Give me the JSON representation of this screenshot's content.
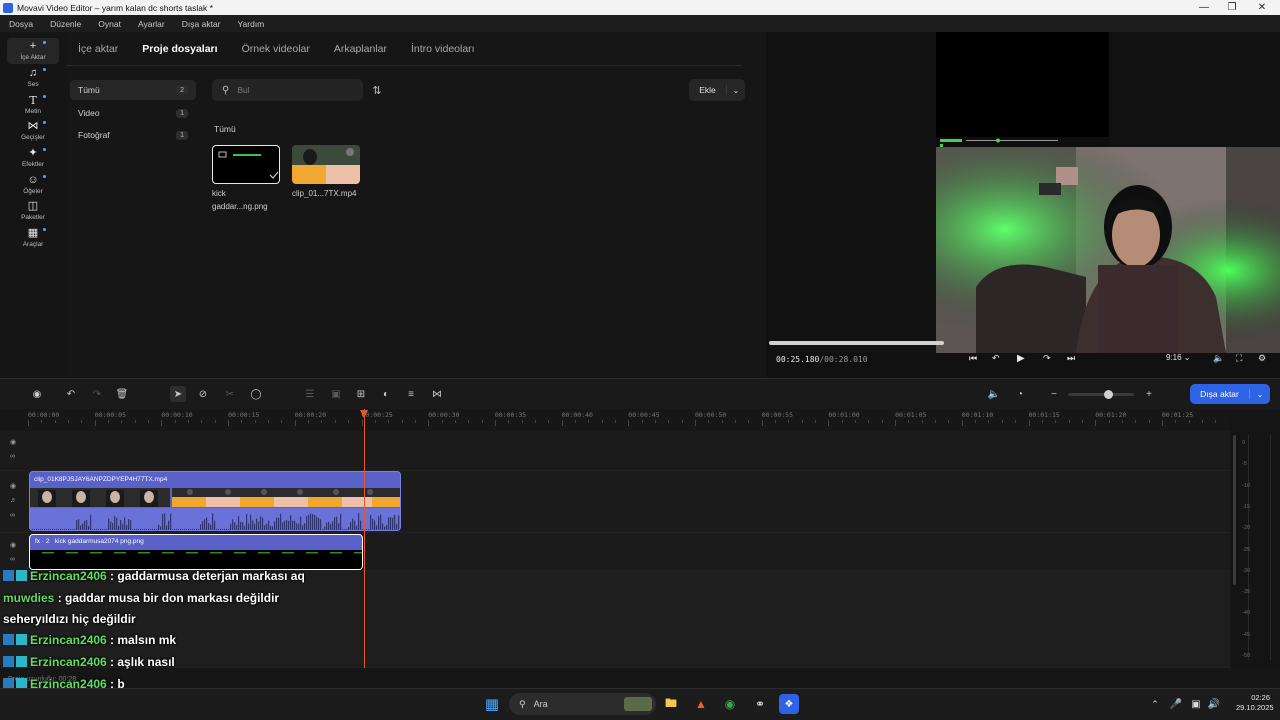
{
  "window": {
    "title": "Movavi Video Editor – yarım kalan dc shorts  taslak *"
  },
  "menu": [
    "Dosya",
    "Düzenle",
    "Oynat",
    "Ayarlar",
    "Dışa aktar",
    "Yardım"
  ],
  "rail": [
    {
      "label": "İçe Aktar",
      "icon": "plus-icon"
    },
    {
      "label": "Ses",
      "icon": "music-icon"
    },
    {
      "label": "Metin",
      "icon": "text-icon"
    },
    {
      "label": "Geçişler",
      "icon": "transitions-icon"
    },
    {
      "label": "Efektler",
      "icon": "effects-icon"
    },
    {
      "label": "Öğeler",
      "icon": "stickers-icon"
    },
    {
      "label": "Paketler",
      "icon": "packages-icon"
    },
    {
      "label": "Araçlar",
      "icon": "tools-icon"
    }
  ],
  "import_tabs": [
    "İçe aktar",
    "Proje dosyaları",
    "Örnek videolar",
    "Arkaplanlar",
    "İntro videoları"
  ],
  "categories": [
    {
      "label": "Tümü",
      "count": "2"
    },
    {
      "label": "Video",
      "count": "1"
    },
    {
      "label": "Fotoğraf",
      "count": "1"
    }
  ],
  "search": {
    "placeholder": "Bul"
  },
  "add_button": "Ekle",
  "section_label": "Tümü",
  "files": [
    {
      "name_line1": "kick",
      "name_line2": "gaddar...ng.png"
    },
    {
      "name_line1": "clip_01...7TX.mp4",
      "name_line2": ""
    }
  ],
  "preview": {
    "current_time": "00:25.180",
    "total_time": "/00:28.010",
    "aspect": "9:16",
    "progress": 0.9
  },
  "export_button": "Dışa aktar",
  "ruler": [
    "00:00:00",
    "00:00:05",
    "00:00:10",
    "00:00:15",
    "00:00:20",
    "00:00:25",
    "00:00:30",
    "00:00:35",
    "00:00:40",
    "00:00:45",
    "00:00:50",
    "00:00:55",
    "00:01:00",
    "00:01:05",
    "00:01:10",
    "00:01:15",
    "00:01:20",
    "00:01:25"
  ],
  "clips": {
    "video": "clip_01K8PJSJAY6ANPZDPYEP4H77TX.mp4",
    "image": "kick gaddarmusa2074 png.png",
    "image_fx": "fx · 2"
  },
  "meter_db": [
    "0",
    "-5",
    "-10",
    "-15",
    "-20",
    "-25",
    "-30",
    "-35",
    "-40",
    "-45",
    "-50"
  ],
  "chat": [
    {
      "user": "Erzincan2406",
      "msg": " : gaddarmusa deterjan markası aq",
      "badges": true
    },
    {
      "user": "muwdies",
      "msg": " : gaddar musa bir don markası değildir",
      "badges": false
    },
    {
      "user": "",
      "msg": "seheryıldızı hiç değildir",
      "badges": false
    },
    {
      "user": "Erzincan2406",
      "msg": " : malsın mk",
      "badges": true
    },
    {
      "user": "Erzincan2406",
      "msg": " : aşlık nasıl",
      "badges": true
    },
    {
      "user": "Erzincan2406",
      "msg": " : b",
      "badges": true
    }
  ],
  "status_text": "Proje uzunluğu: 00:28",
  "taskbar": {
    "search": "Ara",
    "time": "02:26",
    "date": "29.10.2025"
  },
  "colors": {
    "accent": "#2f63e6",
    "clip": "#5a61c8",
    "playhead": "#e8562b",
    "chat_user": "#5fe05f"
  }
}
